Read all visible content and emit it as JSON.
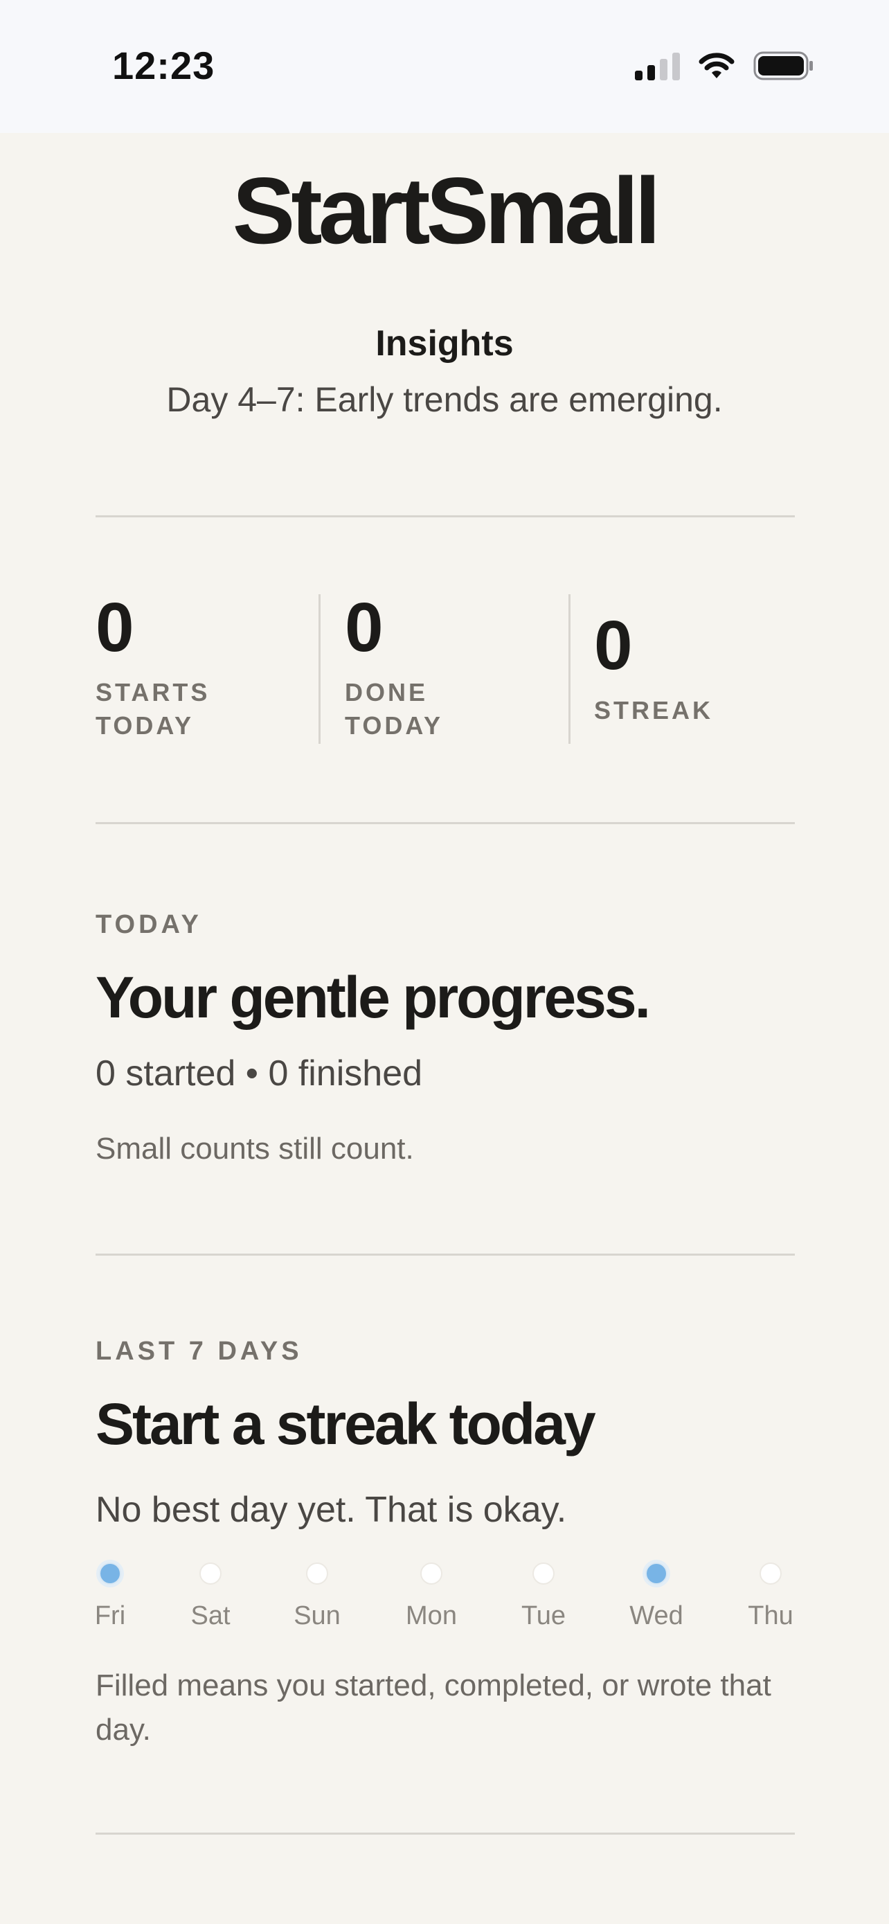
{
  "status_bar": {
    "time": "12:23"
  },
  "app": {
    "title": "StartSmall"
  },
  "insights": {
    "heading": "Insights",
    "subtitle": "Day 4–7: Early trends are emerging."
  },
  "stats": [
    {
      "value": "0",
      "label": "STARTS TODAY"
    },
    {
      "value": "0",
      "label": "DONE TODAY"
    },
    {
      "value": "0",
      "label": "STREAK"
    }
  ],
  "today_card": {
    "eyebrow": "TODAY",
    "title": "Your gentle progress.",
    "summary": "0 started • 0 finished",
    "note": "Small counts still count."
  },
  "week_card": {
    "eyebrow": "LAST 7 DAYS",
    "title": "Start a streak today",
    "subtitle": "No best day yet. That is okay.",
    "days": [
      {
        "label": "Fri",
        "filled": true
      },
      {
        "label": "Sat",
        "filled": false
      },
      {
        "label": "Sun",
        "filled": false
      },
      {
        "label": "Mon",
        "filled": false
      },
      {
        "label": "Tue",
        "filled": false
      },
      {
        "label": "Wed",
        "filled": true
      },
      {
        "label": "Thu",
        "filled": false
      }
    ],
    "legend": "Filled means you started, completed, or wrote that day."
  },
  "colors": {
    "background": "#f6f4ef",
    "text": "#1c1b19",
    "muted": "#75716b",
    "dot_filled": "#78b4e6"
  },
  "icons": {
    "signal": "cellular-signal-icon",
    "wifi": "wifi-icon",
    "battery": "battery-icon"
  }
}
